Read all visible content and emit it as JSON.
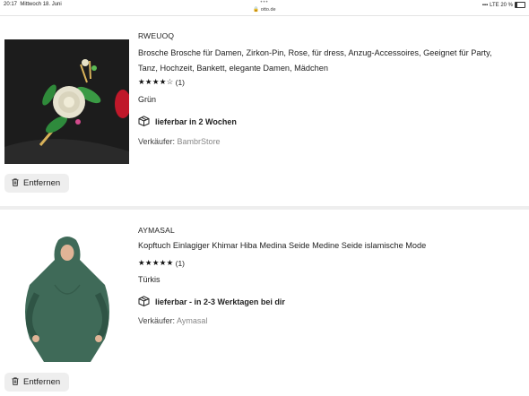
{
  "statusbar": {
    "time": "20:17",
    "date": "Mittwoch 18. Juni",
    "dots": "•••",
    "url": "otto.de",
    "network": "LTE 20 %",
    "battery_level": 0.2
  },
  "items": [
    {
      "brand": "RWEUOQ",
      "title": "Brosche Brosche für Damen, Zirkon-Pin, Rose, für dress, Anzug-Accessoires, Geeignet für Party, Tanz, Hochzeit, Bankett, elegante Damen, Mädchen",
      "stars": "★★★★☆",
      "rating_value": 4,
      "review_count": "(1)",
      "color": "Grün",
      "delivery": "lieferbar in 2 Wochen",
      "seller_label": "Verkäufer:",
      "seller": "BambrStore",
      "remove_label": "Entfernen",
      "image_icon": "brooch-image"
    },
    {
      "brand": "AYMASAL",
      "title": "Kopftuch Einlagiger Khimar Hiba Medina Seide Medine Seide islamische Mode",
      "stars": "★★★★★",
      "rating_value": 5,
      "review_count": "(1)",
      "color": "Türkis",
      "delivery": "lieferbar - in 2-3 Werktagen bei dir",
      "seller_label": "Verkäufer:",
      "seller": "Aymasal",
      "remove_label": "Entfernen",
      "image_icon": "khimar-image"
    }
  ]
}
